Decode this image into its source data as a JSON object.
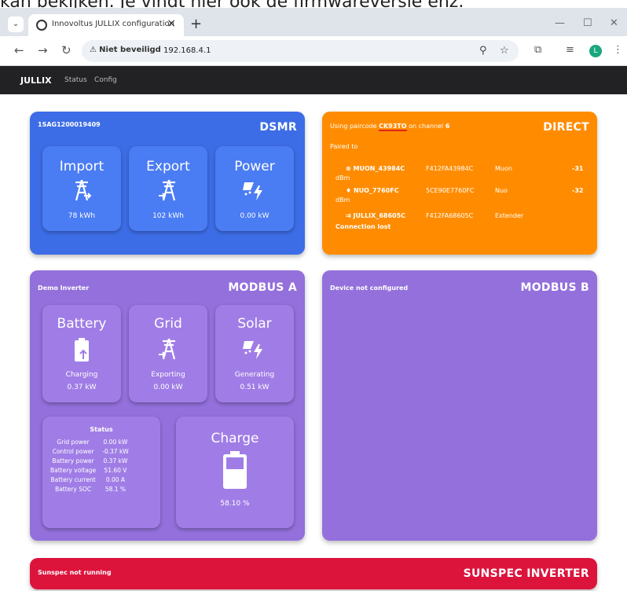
{
  "caption": "kan bekijken. Je vindt hier ook de firmwareversie enz.",
  "browser": {
    "tab_title": "Innovoltus JULLIX configuration",
    "security_label": "Niet beveiligd",
    "url": "192.168.4.1",
    "profile_initial": "L"
  },
  "app": {
    "brand": "JULLIX",
    "nav": [
      "Status",
      "Config"
    ]
  },
  "dsmr": {
    "id": "1SAG1200019409",
    "tag": "DSMR",
    "tiles": [
      {
        "title": "Import",
        "icon": "tower-import-icon",
        "value": "78 kWh"
      },
      {
        "title": "Export",
        "icon": "tower-export-icon",
        "value": "102 kWh"
      },
      {
        "title": "Power",
        "icon": "solar-power-icon",
        "value": "0.00 kW"
      }
    ]
  },
  "direct": {
    "tag": "DIRECT",
    "using_prefix": "Using paircode",
    "paircode": "CK93TO",
    "on_channel": "on channel",
    "channel": "6",
    "paired_to": "Paired to",
    "devices": [
      {
        "name": "MUON_43984C",
        "mac": "F412FA43984C",
        "type": "Muon",
        "rssi": "-31",
        "unit": "dBm"
      },
      {
        "name": "NUO_7760FC",
        "mac": "5CE90E7760FC",
        "type": "Nuo",
        "rssi": "-32",
        "unit": "dBm"
      },
      {
        "name": "JULLIX_68605C",
        "mac": "F412FA68605C",
        "type": "Extender",
        "status": "Connection lost"
      }
    ]
  },
  "modbus_a": {
    "id": "Demo Inverter",
    "tag": "MODBUS A",
    "tiles": [
      {
        "title": "Battery",
        "icon": "battery-charging-icon",
        "sub": "Charging",
        "value": "0.37 kW"
      },
      {
        "title": "Grid",
        "icon": "tower-export-icon",
        "sub": "Exporting",
        "value": "0.00 kW"
      },
      {
        "title": "Solar",
        "icon": "solar-power-icon",
        "sub": "Generating",
        "value": "0.51 kW"
      }
    ],
    "status": {
      "title": "Status",
      "rows": [
        {
          "label": "Grid power",
          "value": "0.00 kW"
        },
        {
          "label": "Control power",
          "value": "-0.37 kW"
        },
        {
          "label": "Battery power",
          "value": "0.37 kW"
        },
        {
          "label": "Battery voltage",
          "value": "51.60 V"
        },
        {
          "label": "Battery current",
          "value": "0.00 A"
        },
        {
          "label": "Battery SOC",
          "value": "58.1 %"
        }
      ]
    },
    "charge": {
      "title": "Charge",
      "value": "58.10 %",
      "level": 0.581
    }
  },
  "modbus_b": {
    "id": "Device not configured",
    "tag": "MODBUS B"
  },
  "sunspec": {
    "id": "Sunspec not running",
    "tag": "SUNSPEC INVERTER"
  },
  "colors": {
    "dsmr": "#3d6de6",
    "dsmr_tile": "#4a7cf3",
    "direct": "#ff8c00",
    "modbus": "#9370db",
    "modbus_tile": "#a07de6",
    "sunspec": "#dc143c",
    "navbar": "#222225"
  }
}
